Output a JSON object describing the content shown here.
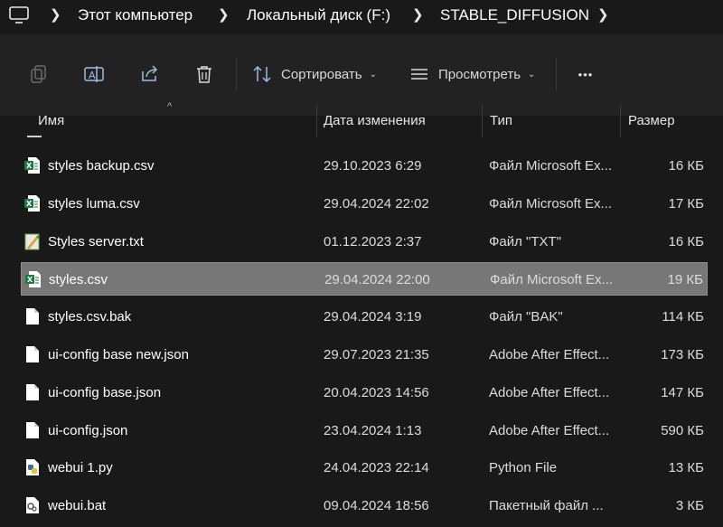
{
  "breadcrumb": [
    "Этот компьютер",
    "Локальный диск (F:)",
    "STABLE_DIFFUSION"
  ],
  "toolbar": {
    "sort_label": "Сортировать",
    "view_label": "Просмотреть",
    "more_label": "•••"
  },
  "columns": {
    "name": "Имя",
    "date": "Дата изменения",
    "type": "Тип",
    "size": "Размер"
  },
  "rows": [
    {
      "icon": "csv-file-icon",
      "name": "styles backup.csv",
      "date": "29.10.2023 6:29",
      "type": "Файл Microsoft Ex...",
      "size": "16 КБ"
    },
    {
      "icon": "csv-file-icon",
      "name": "styles luma.csv",
      "date": "29.04.2024 22:02",
      "type": "Файл Microsoft Ex...",
      "size": "17 КБ"
    },
    {
      "icon": "txt-file-icon",
      "name": "Styles server.txt",
      "date": "01.12.2023 2:37",
      "type": "Файл \"TXT\"",
      "size": "16 КБ"
    },
    {
      "icon": "csv-file-icon",
      "name": "styles.csv",
      "date": "29.04.2024 22:00",
      "type": "Файл Microsoft Ex...",
      "size": "19 КБ",
      "selected": true
    },
    {
      "icon": "blank-file-icon",
      "name": "styles.csv.bak",
      "date": "29.04.2024 3:19",
      "type": "Файл \"BAK\"",
      "size": "114 КБ"
    },
    {
      "icon": "blank-file-icon",
      "name": "ui-config base new.json",
      "date": "29.07.2023 21:35",
      "type": "Adobe After Effect...",
      "size": "173 КБ"
    },
    {
      "icon": "blank-file-icon",
      "name": "ui-config base.json",
      "date": "20.04.2023 14:56",
      "type": "Adobe After Effect...",
      "size": "147 КБ"
    },
    {
      "icon": "blank-file-icon",
      "name": "ui-config.json",
      "date": "23.04.2024 1:13",
      "type": "Adobe After Effect...",
      "size": "590 КБ"
    },
    {
      "icon": "python-file-icon",
      "name": "webui 1.py",
      "date": "24.04.2023 22:14",
      "type": "Python File",
      "size": "13 КБ"
    },
    {
      "icon": "bat-file-icon",
      "name": "webui.bat",
      "date": "09.04.2024 18:56",
      "type": "Пакетный файл ...",
      "size": "3 КБ"
    }
  ],
  "colors": {
    "background": "#191919",
    "toolbar": "#222222",
    "selection": "#777777",
    "excel_green": "#1f7a3f"
  }
}
